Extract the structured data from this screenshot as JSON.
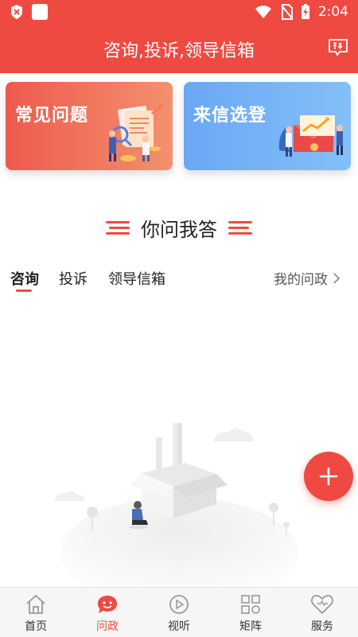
{
  "status_bar": {
    "time": "2:04"
  },
  "header": {
    "title": "咨询,投诉,领导信箱",
    "report_icon": "report-icon"
  },
  "cards": [
    {
      "label": "常见问题"
    },
    {
      "label": "来信选登"
    }
  ],
  "section": {
    "title": "你问我答"
  },
  "tabs": [
    {
      "label": "咨询"
    },
    {
      "label": "投诉"
    },
    {
      "label": "领导信箱"
    }
  ],
  "my_questions": {
    "label": "我的问政"
  },
  "bottom_nav": [
    {
      "label": "首页",
      "icon": "home-icon"
    },
    {
      "label": "问政",
      "icon": "chat-icon"
    },
    {
      "label": "视听",
      "icon": "play-icon"
    },
    {
      "label": "矩阵",
      "icon": "grid-icon"
    },
    {
      "label": "服务",
      "icon": "heart-icon"
    }
  ],
  "colors": {
    "primary": "#ee4a42",
    "card_red": "#ee5a4e",
    "card_blue": "#6aa8f5"
  }
}
